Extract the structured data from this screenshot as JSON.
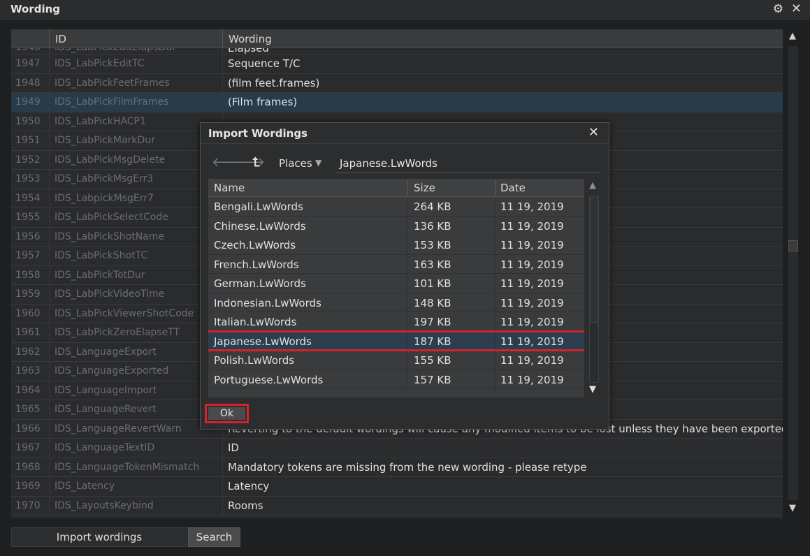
{
  "window": {
    "title": "Wording",
    "icons": {
      "settings": "gear-icon",
      "close": "close-icon"
    }
  },
  "table": {
    "headers": {
      "id": "ID",
      "wording": "Wording"
    },
    "partial_row": {
      "num": "1946",
      "id": "IDS_LabPickEditElapsDur",
      "wording": "Elapsed"
    },
    "rows": [
      {
        "num": "1947",
        "id": "IDS_LabPickEditTC",
        "wording": "Sequence T/C"
      },
      {
        "num": "1948",
        "id": "IDS_LabPickFeetFrames",
        "wording": "(film feet.frames)"
      },
      {
        "num": "1949",
        "id": "IDS_LabPickFilmFrames",
        "wording": "(Film frames)"
      },
      {
        "num": "1950",
        "id": "IDS_LabPickHACP1",
        "wording": ""
      },
      {
        "num": "1951",
        "id": "IDS_LabPickMarkDur",
        "wording": ""
      },
      {
        "num": "1952",
        "id": "IDS_LabPickMsgDelete",
        "wording": ""
      },
      {
        "num": "1953",
        "id": "IDS_LabPickMsgErr3",
        "wording": ""
      },
      {
        "num": "1954",
        "id": "IDS_LabpickMsgErr7",
        "wording": ""
      },
      {
        "num": "1955",
        "id": "IDS_LabPickSelectCode",
        "wording": ""
      },
      {
        "num": "1956",
        "id": "IDS_LabPickShotName",
        "wording": ""
      },
      {
        "num": "1957",
        "id": "IDS_LabPickShotTC",
        "wording": ""
      },
      {
        "num": "1958",
        "id": "IDS_LabPickTotDur",
        "wording": ""
      },
      {
        "num": "1959",
        "id": "IDS_LabPickVideoTime",
        "wording": ""
      },
      {
        "num": "1960",
        "id": "IDS_LabPickViewerShotCode",
        "wording": ""
      },
      {
        "num": "1961",
        "id": "IDS_LabPickZeroElapseTT",
        "wording": ""
      },
      {
        "num": "1962",
        "id": "IDS_LanguageExport",
        "wording": ""
      },
      {
        "num": "1963",
        "id": "IDS_LanguageExported",
        "wording": ""
      },
      {
        "num": "1964",
        "id": "IDS_LanguageImport",
        "wording": ""
      },
      {
        "num": "1965",
        "id": "IDS_LanguageRevert",
        "wording": ""
      },
      {
        "num": "1966",
        "id": "IDS_LanguageRevertWarn",
        "wording": "Reverting to the default wordings will cause any modified items to be lost unless they have been exported to a"
      },
      {
        "num": "1967",
        "id": "IDS_LanguageTextID",
        "wording": "ID"
      },
      {
        "num": "1968",
        "id": "IDS_LanguageTokenMismatch",
        "wording": "Mandatory tokens are missing from the new wording - please retype"
      },
      {
        "num": "1969",
        "id": "IDS_Latency",
        "wording": "Latency"
      },
      {
        "num": "1970",
        "id": "IDS_LayoutsKeybind",
        "wording": "Rooms"
      }
    ],
    "selected_num": "1949"
  },
  "footer": {
    "import_label": "Import wordings",
    "search_label": "Search"
  },
  "dialog": {
    "title": "Import Wordings",
    "places_label": "Places",
    "path": "Japanese.LwWords",
    "columns": {
      "name": "Name",
      "size": "Size",
      "date": "Date"
    },
    "files": [
      {
        "name": "Bengali.LwWords",
        "size": "264 KB",
        "date": "11 19, 2019"
      },
      {
        "name": "Chinese.LwWords",
        "size": "136 KB",
        "date": "11 19, 2019"
      },
      {
        "name": "Czech.LwWords",
        "size": "153 KB",
        "date": "11 19, 2019"
      },
      {
        "name": "French.LwWords",
        "size": "163 KB",
        "date": "11 19, 2019"
      },
      {
        "name": "German.LwWords",
        "size": "101 KB",
        "date": "11 19, 2019"
      },
      {
        "name": "Indonesian.LwWords",
        "size": "148 KB",
        "date": "11 19, 2019"
      },
      {
        "name": "Italian.LwWords",
        "size": "197 KB",
        "date": "11 19, 2019"
      },
      {
        "name": "Japanese.LwWords",
        "size": "187 KB",
        "date": "11 19, 2019"
      },
      {
        "name": "Polish.LwWords",
        "size": "155 KB",
        "date": "11 19, 2019"
      },
      {
        "name": "Portuguese.LwWords",
        "size": "157 KB",
        "date": "11 19, 2019"
      }
    ],
    "selected_file": "Japanese.LwWords",
    "ok_label": "Ok",
    "highlight_color": "#d6222a"
  }
}
